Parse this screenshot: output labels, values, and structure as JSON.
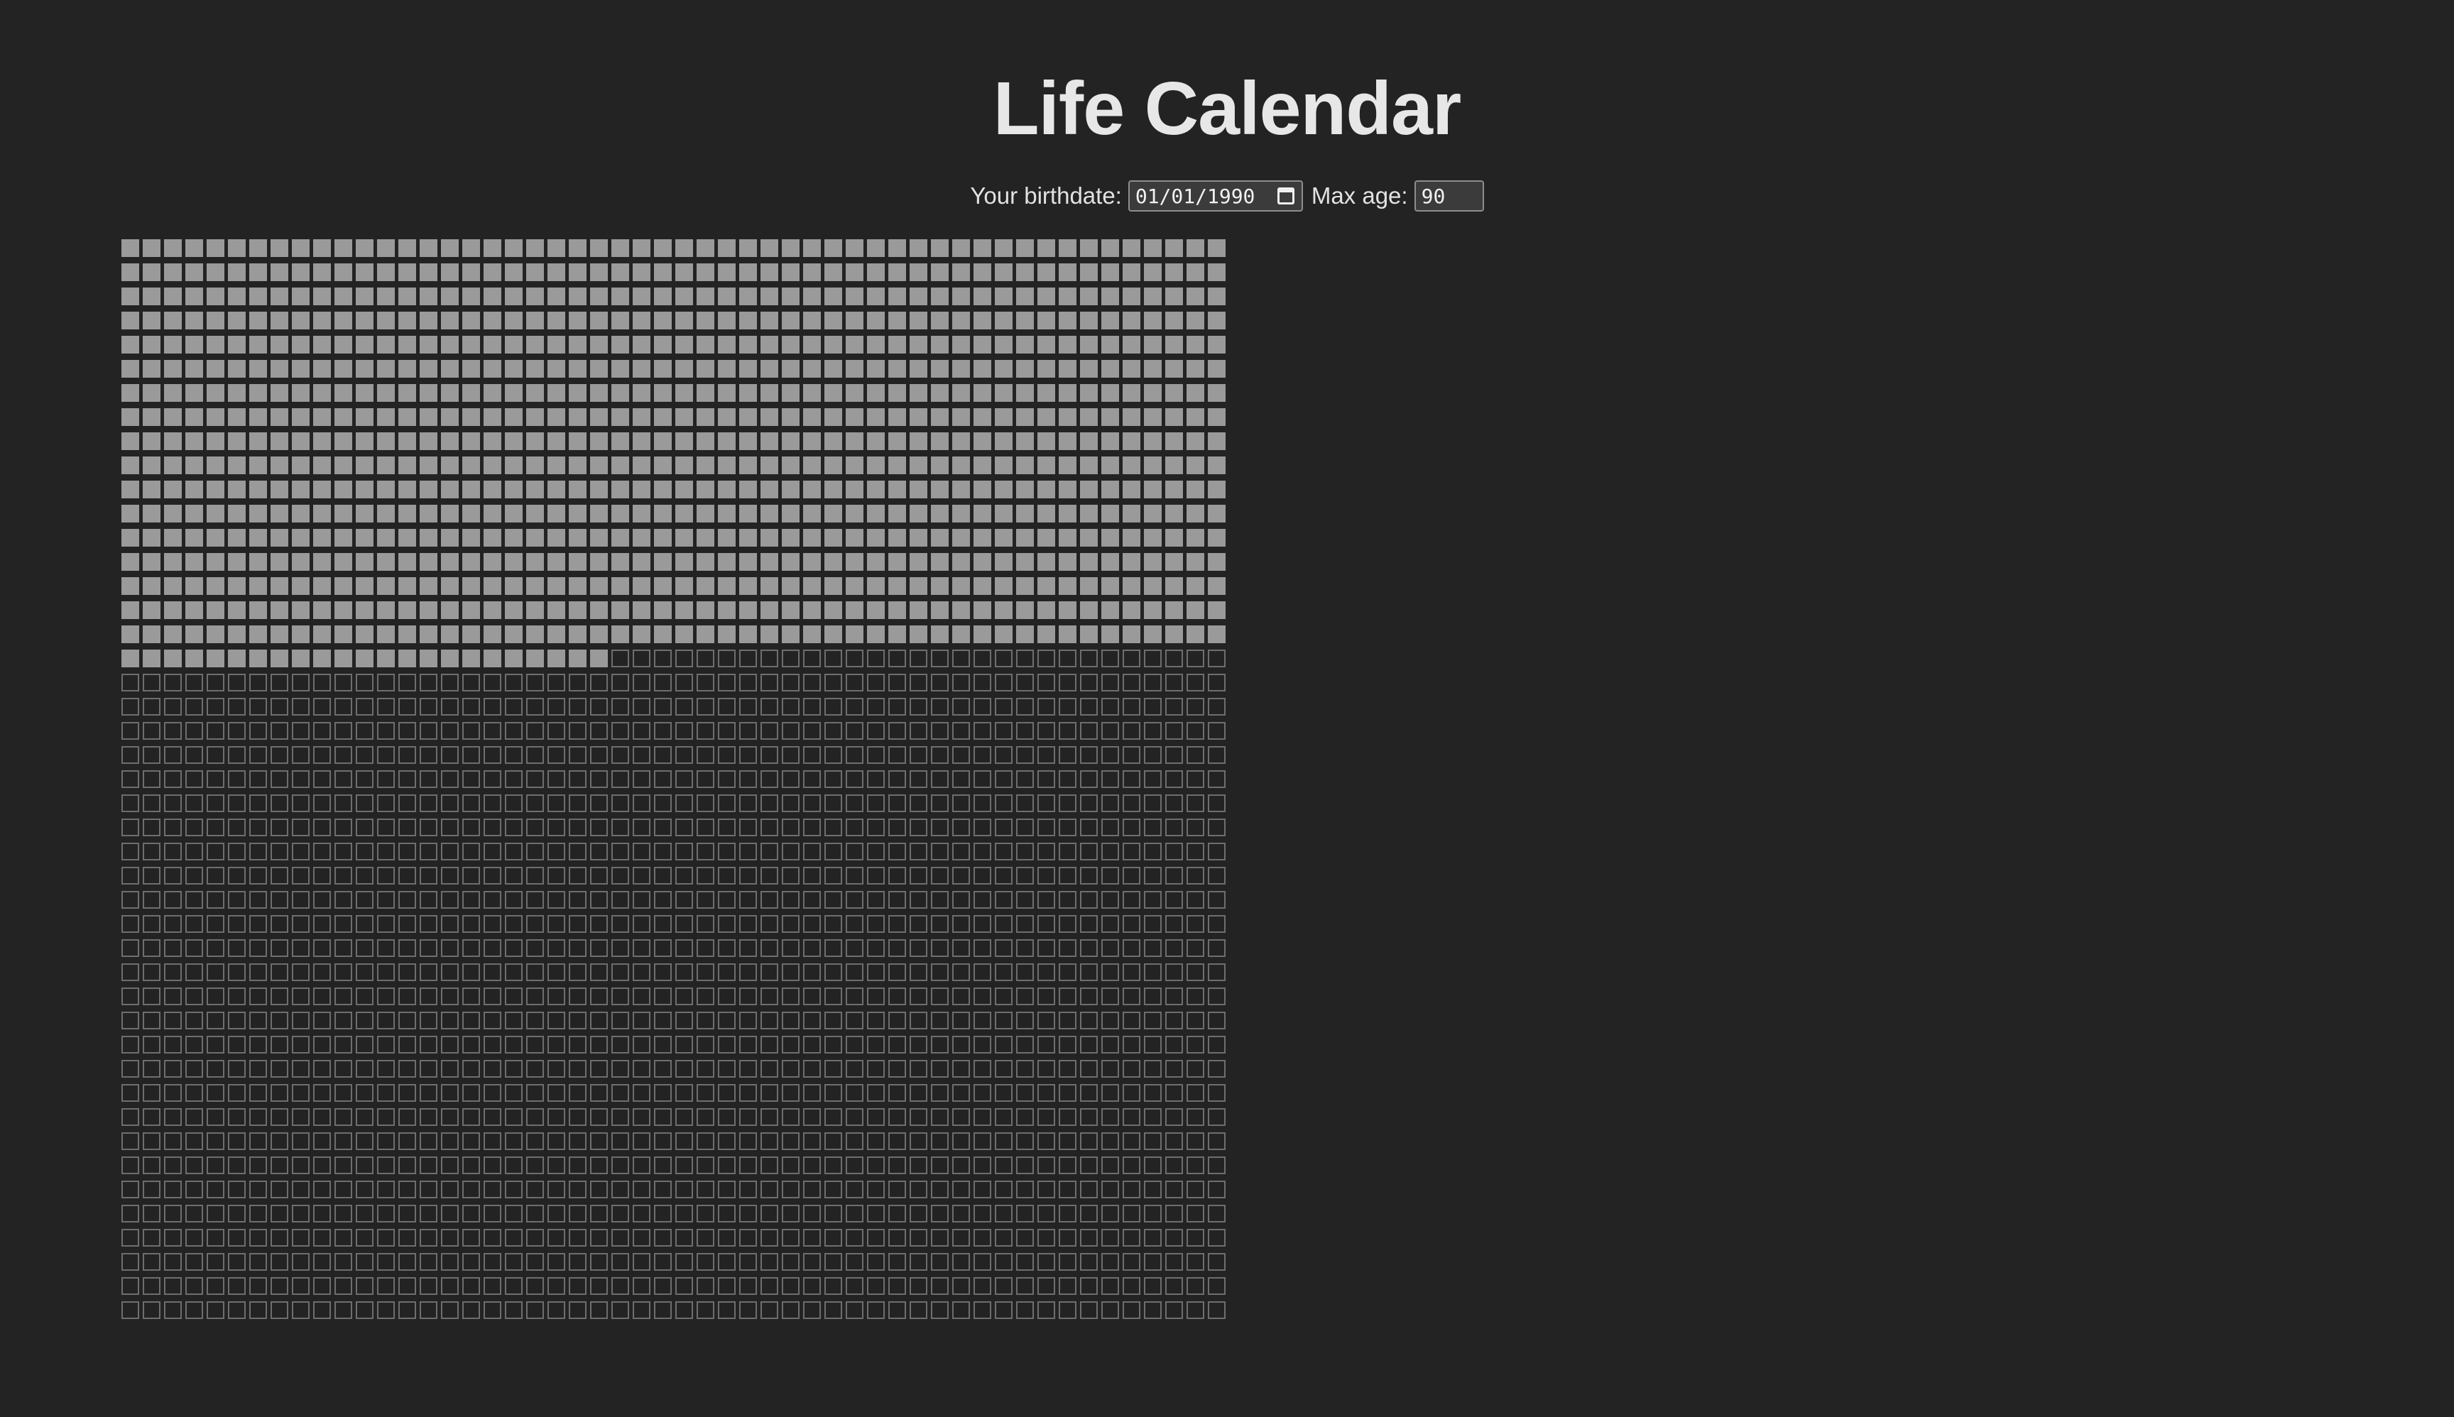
{
  "page": {
    "title": "Life Calendar"
  },
  "controls": {
    "birthdate_label": "Your birthdate:",
    "birthdate_value": "01/01/1990",
    "max_age_label": "Max age:",
    "max_age_value": "90",
    "calendar_icon": "calendar-icon"
  },
  "calendar": {
    "weeks_per_row": 52,
    "rows_shown": 45,
    "lived_weeks": 907,
    "colors": {
      "background": "#232323",
      "lived": "#9a9a9a",
      "future_border": "#6e6e6e",
      "text": "#e4e4e4"
    }
  }
}
